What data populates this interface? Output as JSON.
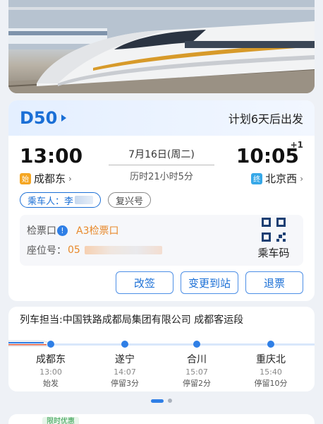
{
  "ticket": {
    "train_no": "D50",
    "depart_note": "计划6天后出发",
    "dep_time": "13:00",
    "arr_time": "10:05",
    "day_offset": "+1",
    "date": "7月16日(周二)",
    "duration": "历时21小时5分",
    "from_badge": "始",
    "from_station": "成都东",
    "to_badge": "终",
    "to_station": "北京西",
    "passenger_label": "乘车人：李",
    "train_type": "复兴号",
    "gate_label": "检票口",
    "gate_value": "A3检票口",
    "seat_label": "座位号：",
    "seat_value": "05",
    "qr_label": "乘车码",
    "actions": [
      "改签",
      "变更到站",
      "退票"
    ]
  },
  "operator": "列车担当:中国铁路成都局集团有限公司 成都客运段",
  "stops": [
    {
      "name": "成都东",
      "time": "13:00",
      "status": "始发"
    },
    {
      "name": "遂宁",
      "time": "14:07",
      "status": "停留3分"
    },
    {
      "name": "合川",
      "time": "15:07",
      "status": "停留2分"
    },
    {
      "name": "重庆北",
      "time": "15:40",
      "status": "停留10分"
    }
  ],
  "promo_tag": "限时优惠",
  "colors": {
    "accent": "#1a6fd6",
    "orange": "#e8892b",
    "start_badge": "#f5a623",
    "end_badge": "#37a8e8"
  }
}
